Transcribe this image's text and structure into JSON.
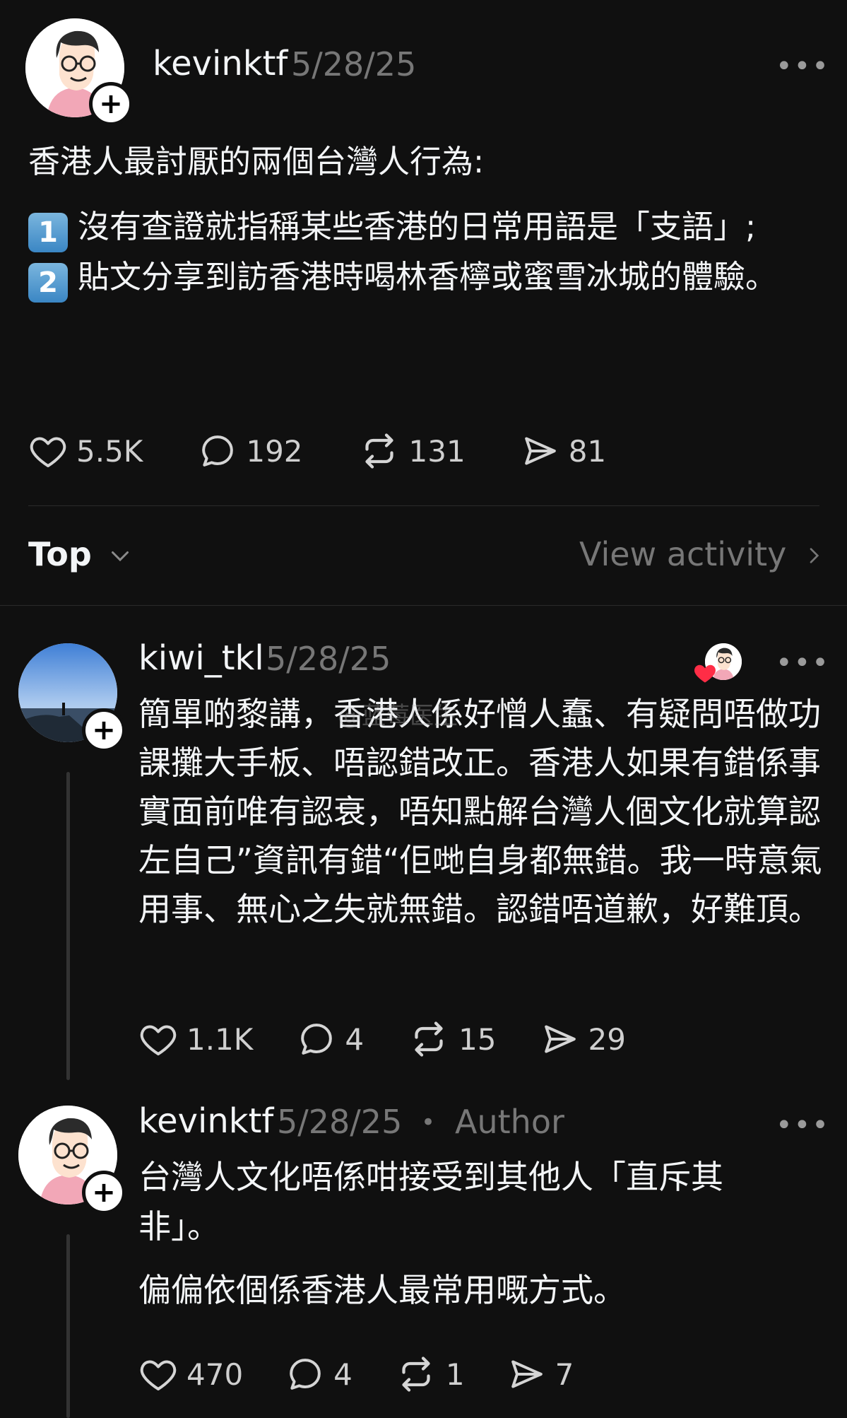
{
  "post": {
    "username": "kevinktf",
    "date": "5/28/25",
    "heading": "香港人最討厭的兩個台灣人行為:",
    "item1_num": "1",
    "item1_text": "沒有查證就指稱某些香港的日常用語是「支語」;",
    "item2_num": "2",
    "item2_text": "貼文分享到訪香港時喝林香檸或蜜雪冰城的體驗。",
    "likes": "5.5K",
    "comments": "192",
    "reposts": "131",
    "shares": "81"
  },
  "sort": {
    "label": "Top",
    "view_activity": "View activity"
  },
  "reply1": {
    "username": "kiwi_tkl",
    "date": "5/28/25",
    "text": "簡單啲黎講，香港人係好憎人蠢、有疑問唔做功課攤大手板、唔認錯改正。香港人如果有錯係事實面前唯有認衰，唔知點解台灣人個文化就算認左自己”資訊有錯“佢哋自身都無錯。我一時意氣用事、無心之失就無錯。認錯唔道歉，好難頂。",
    "likes": "1.1K",
    "comments": "4",
    "reposts": "15",
    "shares": "29"
  },
  "reply2": {
    "username": "kevinktf",
    "date": "5/28/25",
    "author_dot": "•",
    "author_tag": "Author",
    "text1": "台灣人文化唔係咁接受到其他人「直斥其非」。",
    "text2": "偏偏依個係香港人最常用嘅方式。",
    "likes": "470",
    "comments": "4",
    "reposts": "1",
    "shares": "7"
  },
  "watermark": "@蓝莓医生",
  "more_glyph": "•••",
  "plus_glyph": "+",
  "colors": {
    "background": "#101010",
    "text": "#f3f5f7",
    "muted": "#777777",
    "heart": "#ff2d46"
  },
  "icons": {
    "like": "heart-icon",
    "comment": "comment-bubble-icon",
    "repost": "repost-icon",
    "share": "send-icon",
    "more": "more-dots-icon",
    "chevron": "chevron-down-icon"
  }
}
